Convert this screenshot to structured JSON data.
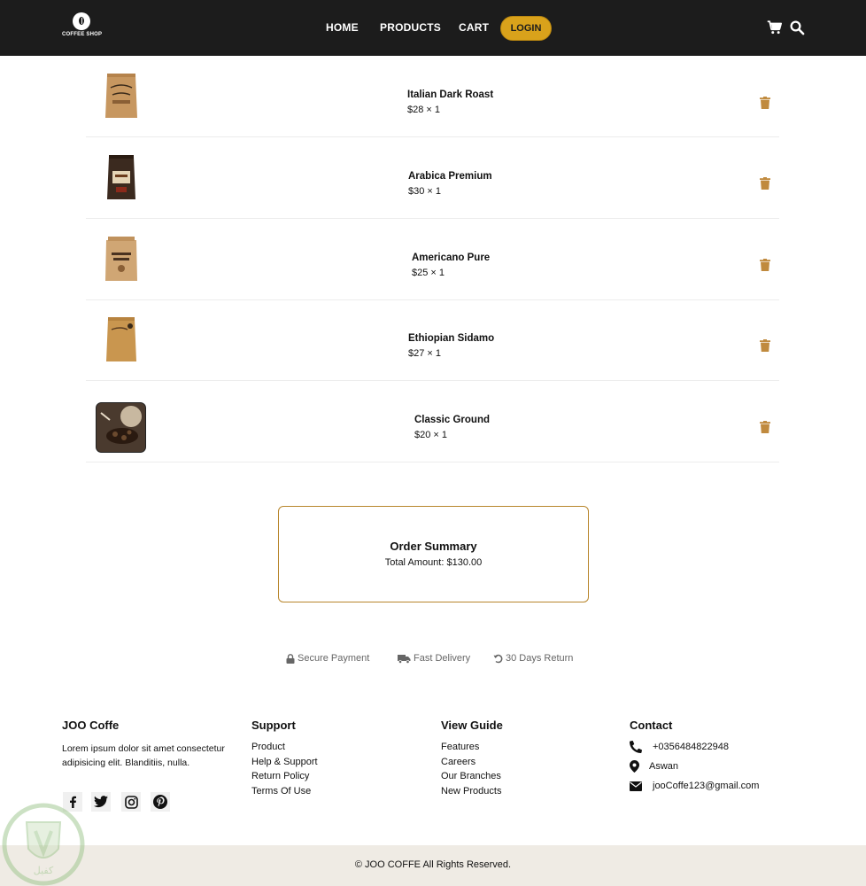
{
  "header": {
    "logo_text": "COFFEE SHOP",
    "nav": [
      {
        "label": "HOME"
      },
      {
        "label": "PRODUCTS"
      },
      {
        "label": "CART"
      }
    ],
    "login_label": "LOGIN",
    "icons": [
      "cart-icon",
      "search-icon"
    ]
  },
  "cart": {
    "items": [
      {
        "name": "Italian Dark Roast",
        "price": "$28 × 1",
        "image": "kraft-coffee-bag"
      },
      {
        "name": "Arabica Premium",
        "price": "$30 × 1",
        "image": "dark-coffee-bag"
      },
      {
        "name": "Americano Pure",
        "price": "$25 × 1",
        "image": "kraft-coffee-bag"
      },
      {
        "name": "Ethiopian Sidamo",
        "price": "$27 × 1",
        "image": "kraft-coffee-bag"
      },
      {
        "name": "Classic Ground",
        "price": "$20 × 1",
        "image": "coffee-beans-photo"
      }
    ],
    "remove_icon": "trash-icon"
  },
  "summary": {
    "title": "Order Summary",
    "total": "Total Amount: $130.00"
  },
  "badges": [
    {
      "label": "Secure Payment",
      "icon": "lock-icon"
    },
    {
      "label": "Fast Delivery",
      "icon": "truck-icon"
    },
    {
      "label": "30 Days Return",
      "icon": "undo-icon"
    }
  ],
  "footer": {
    "brand": {
      "title": "JOO Coffe",
      "text": "Lorem ipsum dolor sit amet consectetur adipisicing elit. Blanditiis, nulla.",
      "social": [
        "facebook-icon",
        "twitter-icon",
        "instagram-icon",
        "pinterest-icon"
      ]
    },
    "support": {
      "title": "Support",
      "links": [
        "Product",
        "Help & Support",
        "Return Policy",
        "Terms Of Use"
      ]
    },
    "guide": {
      "title": "View Guide",
      "links": [
        "Features",
        "Careers",
        "Our Branches",
        "New Products"
      ]
    },
    "contact": {
      "title": "Contact",
      "phone": "+0356484822948",
      "location": "Aswan",
      "email": "jooCoffe123@gmail.com"
    },
    "copyright": "© JOO COFFE All Rights Reserved."
  },
  "watermark_text": "كفيل",
  "colors": {
    "header_bg": "#1c1c1c",
    "accent": "#d9a21b",
    "trash": "#c08a3e",
    "summary_border": "#b8862c",
    "bottom_bar": "#efebe4"
  }
}
